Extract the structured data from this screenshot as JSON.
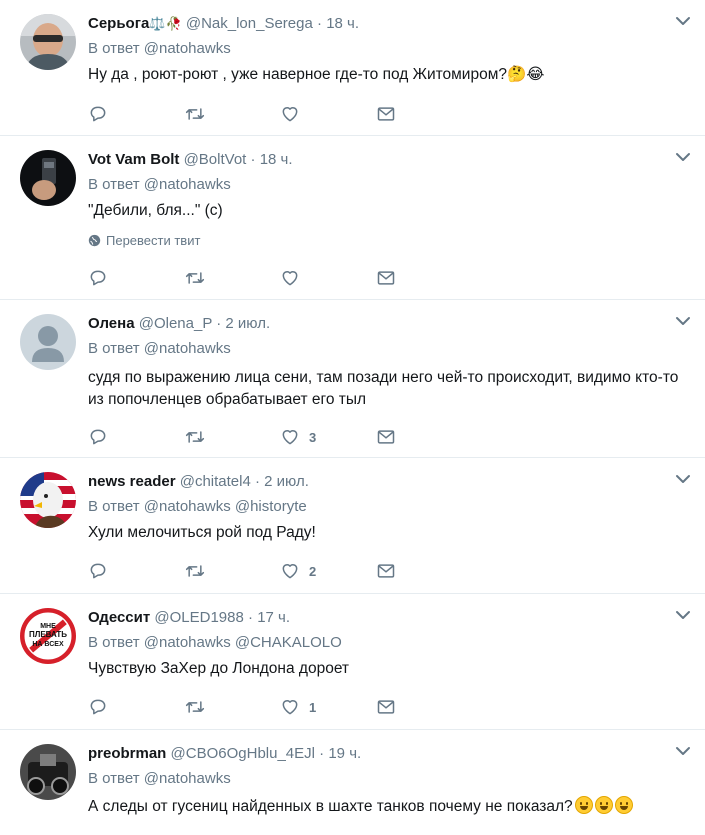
{
  "tweets": [
    {
      "name": "Серьога",
      "name_emoji": "⚖️🥀",
      "handle": "@Nak_lon_Serega",
      "time": "18 ч.",
      "reply_prefix": "В ответ",
      "reply_to": "@natohawks",
      "text": "Ну да , роют-роют , уже наверное где-то под Житомиром?",
      "text_emoji": "🤔😂",
      "likes": "",
      "translate": ""
    },
    {
      "name": "Vot Vam Bolt",
      "name_emoji": "",
      "handle": "@BoltVot",
      "time": "18 ч.",
      "reply_prefix": "В ответ",
      "reply_to": "@natohawks",
      "text": "\"Дебили, бля...\" (с)",
      "text_emoji": "",
      "likes": "",
      "translate": "Перевести твит"
    },
    {
      "name": "Олена",
      "name_emoji": "",
      "handle": "@Olena_P",
      "time": "2 июл.",
      "reply_prefix": "В ответ",
      "reply_to": "@natohawks",
      "text": "судя по выражению лица сени, там позади него чей-то происходит, видимо кто-то из попочленцев обрабатывает его тыл",
      "text_emoji": "",
      "likes": "3",
      "translate": ""
    },
    {
      "name": "news reader",
      "name_emoji": "",
      "handle": "@chitatel4",
      "time": "2 июл.",
      "reply_prefix": "В ответ",
      "reply_to": "@natohawks @historyte",
      "text": "Хули мелочиться рой под Раду!",
      "text_emoji": "",
      "likes": "2",
      "translate": ""
    },
    {
      "name": "Одессит",
      "name_emoji": "",
      "handle": "@OLED1988",
      "time": "17 ч.",
      "reply_prefix": "В ответ",
      "reply_to": "@natohawks @CHAKALOLO",
      "text": "Чувствую ЗаХер  до Лондона дороет",
      "text_emoji": "",
      "likes": "1",
      "translate": "",
      "avatar_text": [
        "МНЕ",
        "ПЛЕВАТЬ",
        "НА ВСЕХ"
      ]
    },
    {
      "name": "preobrman",
      "name_emoji": "",
      "handle": "@CBO6OgHblu_4EJl",
      "time": "19 ч.",
      "reply_prefix": "В ответ",
      "reply_to": "@natohawks",
      "text": "А следы от гусениц найденных в шахте танков почему не показал?",
      "text_emoji": "",
      "likes": "",
      "translate": ""
    }
  ],
  "separator": "·",
  "icons": {
    "reply": "reply-icon",
    "retweet": "retweet-icon",
    "like": "heart-icon",
    "dm": "envelope-icon",
    "caret": "chevron-down-icon",
    "globe": "globe-icon"
  },
  "colors": {
    "text": "#14171a",
    "muted": "#657786",
    "border": "#e6ecf0",
    "icon": "#657786"
  }
}
